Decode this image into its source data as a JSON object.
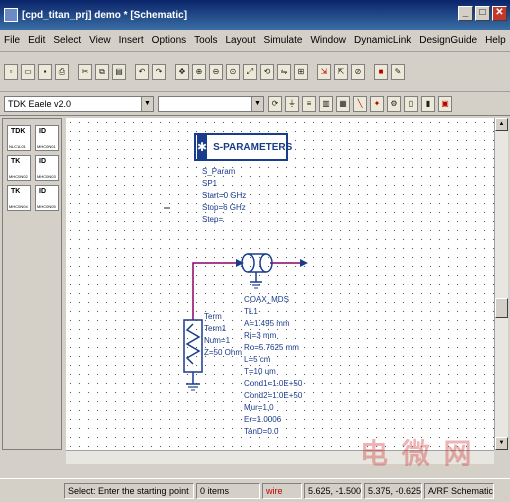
{
  "window": {
    "title": "[cpd_titan_prj] demo * [Schematic]"
  },
  "menu": [
    "File",
    "Edit",
    "Select",
    "View",
    "Insert",
    "Options",
    "Tools",
    "Layout",
    "Simulate",
    "Window",
    "DynamicLink",
    "DesignGuide",
    "Help"
  ],
  "toolbar": {
    "library_select": "TDK Eaele v2.0",
    "component_select": ""
  },
  "palette": {
    "items": [
      {
        "glyph": "TDK",
        "caption": "NLC1L01"
      },
      {
        "glyph": "ID",
        "caption": "MHC0N01"
      },
      {
        "glyph": "TK",
        "caption": "MHC0N02"
      },
      {
        "glyph": "ID",
        "caption": "MHC0N03"
      },
      {
        "glyph": "TK",
        "caption": "MHC0N04"
      },
      {
        "glyph": "ID",
        "caption": "MHC0N05"
      }
    ]
  },
  "schematic": {
    "sparam_block": {
      "label": "S-PARAMETERS",
      "lines": [
        "S_Param",
        "SP1",
        "Start=0 GHz",
        "Stop=6 GHz",
        "Step="
      ]
    },
    "term": {
      "lines": [
        "Term",
        "Term1",
        "Num=1",
        "Z=50 Ohm"
      ]
    },
    "coax": {
      "lines": [
        "COAX_MDS",
        "TL1",
        "A=1.495 mm",
        "Ri=3 mm",
        "Ro=5.7625 mm",
        "L=5 cm",
        "T=10 um",
        "Cond1=1.0E+50",
        "Cond2=1.0E+50",
        "Mur=1.0",
        "Er=1.0006",
        "TanD=0.0"
      ]
    }
  },
  "status": {
    "message": "Select: Enter the starting point",
    "count": "0 items",
    "layer": "wire",
    "coords1": "5.625, -1.500",
    "coords2": "5.375, -0.625",
    "mode": "A/RF Schematic"
  },
  "colors": {
    "wire": "#8b0066",
    "component": "#1a3c8c",
    "ground": "#1a3c8c"
  }
}
